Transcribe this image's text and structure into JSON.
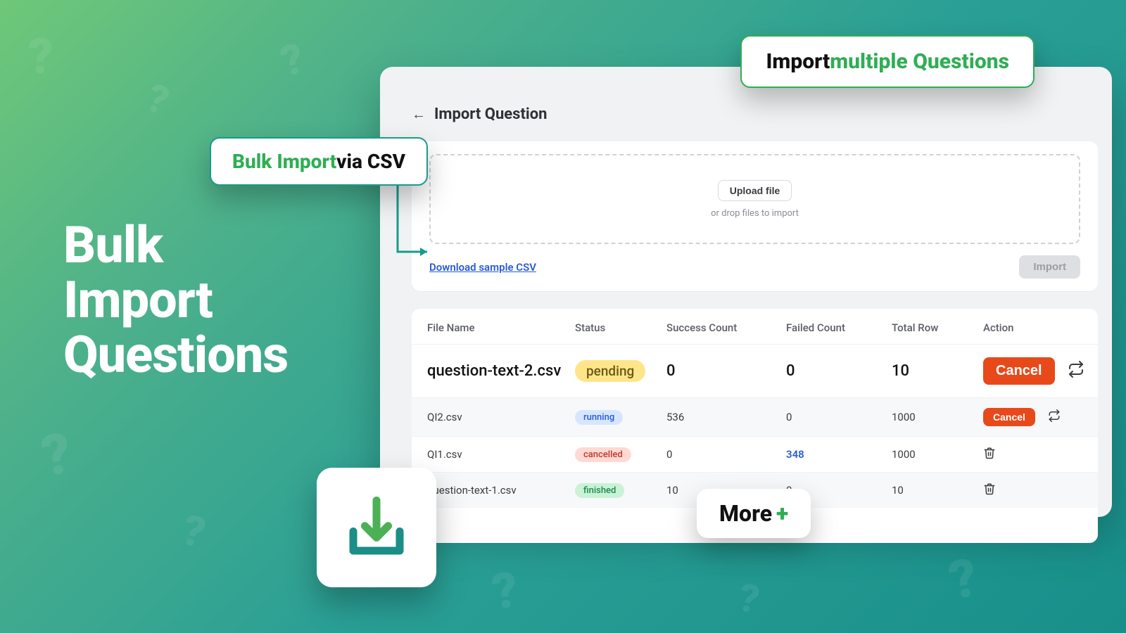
{
  "hero": {
    "line1": "Bulk",
    "line2": "Import",
    "line3": "Questions"
  },
  "callouts": {
    "top_prefix": "Import ",
    "top_accent": "multiple Questions",
    "csv_accent": "Bulk Import",
    "csv_suffix": " via CSV",
    "more_label": "More",
    "more_plus": "+"
  },
  "panel": {
    "title": "Import Question",
    "upload_btn": "Upload file",
    "drop_hint": "or drop files to import",
    "download_link": "Download sample CSV",
    "import_btn": "Import"
  },
  "table": {
    "headers": {
      "file": "File Name",
      "status": "Status",
      "success": "Success Count",
      "failed": "Failed Count",
      "total": "Total Row",
      "action": "Action"
    },
    "cancel_label": "Cancel",
    "rows": [
      {
        "file": "question-text-2.csv",
        "status": "pending",
        "status_class": "b-pending",
        "success": "0",
        "failed": "0",
        "failed_link": false,
        "total": "10",
        "action": "cancel_big"
      },
      {
        "file": "QI2.csv",
        "status": "running",
        "status_class": "b-running",
        "success": "536",
        "failed": "0",
        "failed_link": false,
        "total": "1000",
        "action": "cancel_sm"
      },
      {
        "file": "QI1.csv",
        "status": "cancelled",
        "status_class": "b-cancel",
        "success": "0",
        "failed": "348",
        "failed_link": true,
        "total": "1000",
        "action": "trash"
      },
      {
        "file": "question-text-1.csv",
        "status": "finished",
        "status_class": "b-finish",
        "success": "10",
        "failed": "0",
        "failed_link": false,
        "total": "10",
        "action": "trash"
      }
    ]
  }
}
